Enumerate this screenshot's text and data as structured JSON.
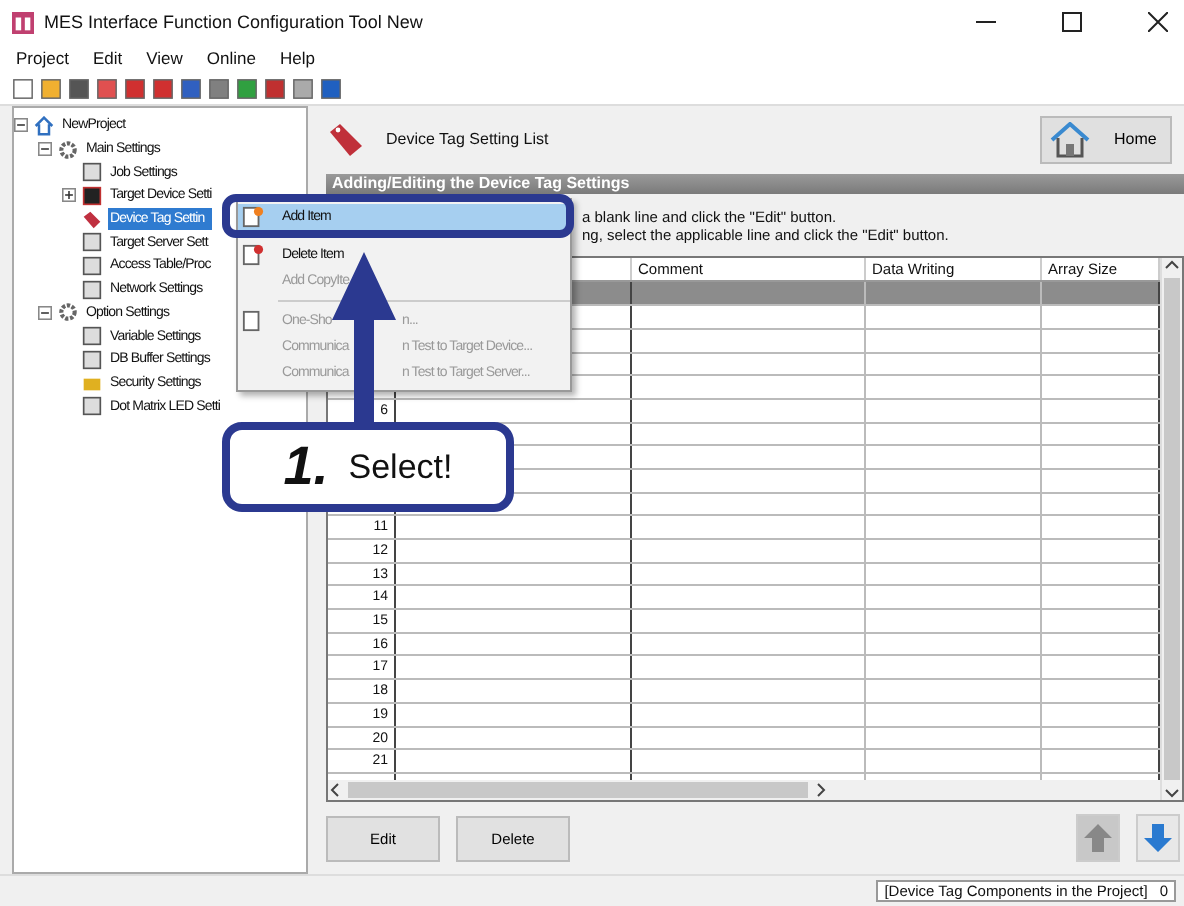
{
  "window": {
    "title": "MES Interface Function Configuration Tool New"
  },
  "menu": [
    "Project",
    "Edit",
    "View",
    "Online",
    "Help"
  ],
  "tree": [
    {
      "label": "NewProject",
      "expanded": true,
      "selected": false,
      "children": [
        {
          "label": "Main Settings",
          "expanded": true,
          "selected": false,
          "children": [
            {
              "label": "Job Settings",
              "selected": false
            },
            {
              "label": "Target Device Setti",
              "expanded": false,
              "selected": false
            },
            {
              "label": "Device Tag Settin",
              "selected": true
            },
            {
              "label": "Target Server Sett",
              "selected": false
            },
            {
              "label": "Access Table/Proc",
              "selected": false
            },
            {
              "label": "Network Settings",
              "selected": false
            }
          ]
        },
        {
          "label": "Option Settings",
          "expanded": true,
          "selected": false,
          "children": [
            {
              "label": "Variable Settings",
              "selected": false
            },
            {
              "label": "DB Buffer Settings",
              "selected": false
            },
            {
              "label": "Security Settings",
              "selected": false
            },
            {
              "label": "Dot Matrix LED Setti",
              "selected": false
            }
          ]
        }
      ]
    }
  ],
  "page_title": "Device Tag Setting List",
  "home_button": "Home",
  "section_title": "Adding/Editing the Device Tag Settings",
  "instructions": [
    "a blank line and click the \"Edit\" button.",
    "ng, select the applicable line and click the \"Edit\" button."
  ],
  "table": {
    "columns": [
      "Comment",
      "Data Writing",
      "Array Size"
    ],
    "rows": [
      {
        "selected": true
      },
      {
        "selected": false
      },
      {
        "selected": false
      },
      {
        "selected": false
      },
      {
        "selected": false
      },
      {
        "number": "6",
        "selected": false
      },
      {
        "selected": false
      },
      {
        "selected": false
      },
      {
        "selected": false
      },
      {
        "selected": false
      },
      {
        "number": "11",
        "selected": false
      },
      {
        "number": "12",
        "selected": false
      },
      {
        "number": "13",
        "selected": false
      },
      {
        "number": "14",
        "selected": false
      },
      {
        "number": "15",
        "selected": false
      },
      {
        "number": "16",
        "selected": false
      },
      {
        "number": "17",
        "selected": false
      },
      {
        "number": "18",
        "selected": false
      },
      {
        "number": "19",
        "selected": false
      },
      {
        "number": "20",
        "selected": false
      },
      {
        "number": "21",
        "selected": false
      },
      {
        "selected": false
      }
    ]
  },
  "buttons": [
    "Edit",
    "Delete"
  ],
  "context_menu": [
    {
      "kind": "item",
      "texts": [
        "Add Item"
      ],
      "disabled": false,
      "selected": true
    },
    {
      "kind": "item",
      "texts": [
        "Delete Item"
      ],
      "disabled": false,
      "selected": false
    },
    {
      "kind": "item",
      "texts": [
        "Add CopyIte"
      ],
      "disabled": true,
      "selected": false
    },
    {
      "kind": "separator"
    },
    {
      "kind": "item",
      "texts": [
        "One-Sho",
        "n..."
      ],
      "disabled": true,
      "selected": false
    },
    {
      "kind": "item",
      "texts": [
        "Communica",
        "n Test to Target Device..."
      ],
      "disabled": true,
      "selected": false
    },
    {
      "kind": "item",
      "texts": [
        "Communica",
        "n Test to Target Server..."
      ],
      "disabled": true,
      "selected": false
    }
  ],
  "status_bar": {
    "label": "[Device Tag Components in the Project]",
    "count": "0"
  },
  "callout": {
    "number": "1.",
    "text": "Select!"
  }
}
